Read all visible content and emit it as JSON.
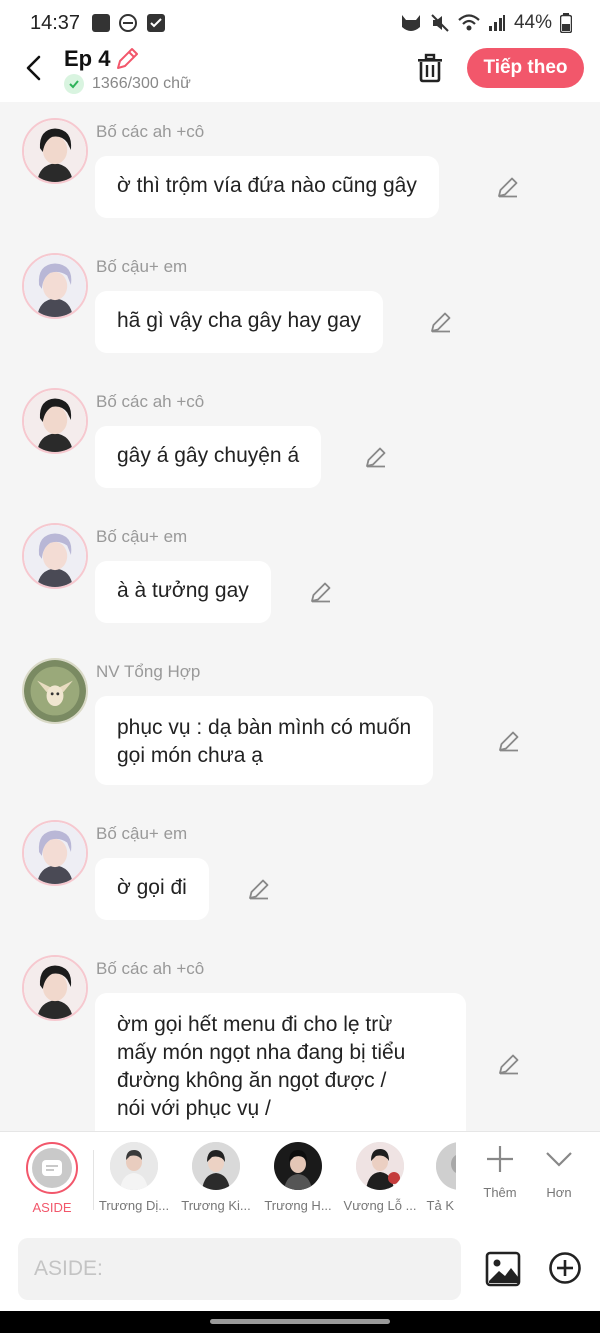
{
  "status_bar": {
    "time": "14:37",
    "battery": "44%"
  },
  "header": {
    "title": "Ep 4",
    "counter": "1366/300 chữ",
    "next_label": "Tiếp theo"
  },
  "messages": [
    {
      "name": "Bố các ah +cô",
      "text": "ờ thì trộm vía đứa nào cũng gây",
      "avatar": "dark-hair-avatar"
    },
    {
      "name": "Bố cậu+ em",
      "text": "hã gì vậy cha gây hay gay",
      "avatar": "silver-hair-avatar"
    },
    {
      "name": "Bố các ah +cô",
      "text": "gây á gây chuyện á",
      "avatar": "dark-hair-avatar"
    },
    {
      "name": "Bố cậu+ em",
      "text": "à à tưởng gay",
      "avatar": "silver-hair-avatar"
    },
    {
      "name": "NV Tổng Hợp",
      "text_lines": [
        "phục vụ : dạ bàn mình có muốn",
        "gọi món chưa ạ"
      ],
      "avatar": "fox-avatar"
    },
    {
      "name": "Bố cậu+ em",
      "text": "ờ gọi đi",
      "avatar": "silver-hair-avatar"
    },
    {
      "name": "Bố các ah +cô",
      "text_lines": [
        "ờm gọi hết menu đi cho lẹ trừ",
        "mấy món ngọt nha đang bị tiểu",
        "đường không ăn ngọt được /",
        "nói với phục vụ /"
      ],
      "avatar": "dark-hair-avatar"
    }
  ],
  "characters": [
    {
      "label": "ASIDE"
    },
    {
      "label": "Trương Dị..."
    },
    {
      "label": "Trương Ki..."
    },
    {
      "label": "Trương H..."
    },
    {
      "label": "Vương Lỗ ..."
    },
    {
      "label": "Tả K"
    }
  ],
  "tools": {
    "add_label": "Thêm",
    "more_label": "Hơn"
  },
  "input": {
    "placeholder": "ASIDE:"
  },
  "colors": {
    "accent": "#f2576b",
    "background": "#f5f5f5",
    "bubble": "#ffffff"
  }
}
